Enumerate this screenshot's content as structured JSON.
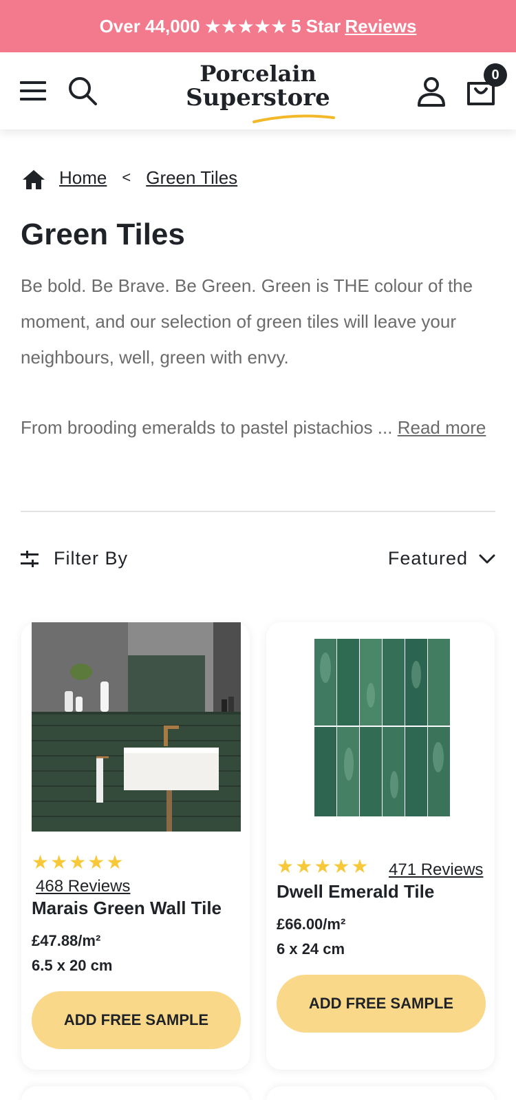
{
  "promo": {
    "prefix": "Over 44,000",
    "stars": "★★★★★",
    "suffix": "5 Star",
    "link": "Reviews"
  },
  "header": {
    "logo_line1": "Porcelain",
    "logo_line2": "Superstore",
    "cart_count": "0"
  },
  "breadcrumb": {
    "home": "Home",
    "separator": "<",
    "current": "Green Tiles"
  },
  "page": {
    "title": "Green Tiles",
    "description_1": "Be bold. Be Brave. Be Green. Green is THE colour of the moment, and our selection of green tiles will leave your neighbours, well, green with envy.",
    "description_2": "From brooding emeralds to pastel pistachios ...",
    "read_more": "Read more"
  },
  "toolbar": {
    "filter_label": "Filter By",
    "sort_label": "Featured"
  },
  "products": [
    {
      "stars": "★★★★★",
      "reviews": "468 Reviews",
      "name": "Marais Green Wall Tile",
      "price": "£47.88/m²",
      "size": "6.5 x 20 cm",
      "button": "ADD FREE SAMPLE"
    },
    {
      "stars": "★★★★★",
      "reviews": "471 Reviews",
      "name": "Dwell Emerald Tile",
      "price": "£66.00/m²",
      "size": "6 x 24 cm",
      "button": "ADD FREE SAMPLE"
    }
  ],
  "colors": {
    "promo_bg": "#f27a8c",
    "button_bg": "#fad88a",
    "star": "#f7c83a",
    "text_dark": "#1f2328",
    "text_muted": "#6b6b6b",
    "logo_accent": "#f2b828"
  },
  "icons": [
    "menu-icon",
    "search-icon",
    "user-icon",
    "cart-icon",
    "home-icon",
    "filter-icon",
    "chevron-down-icon"
  ]
}
